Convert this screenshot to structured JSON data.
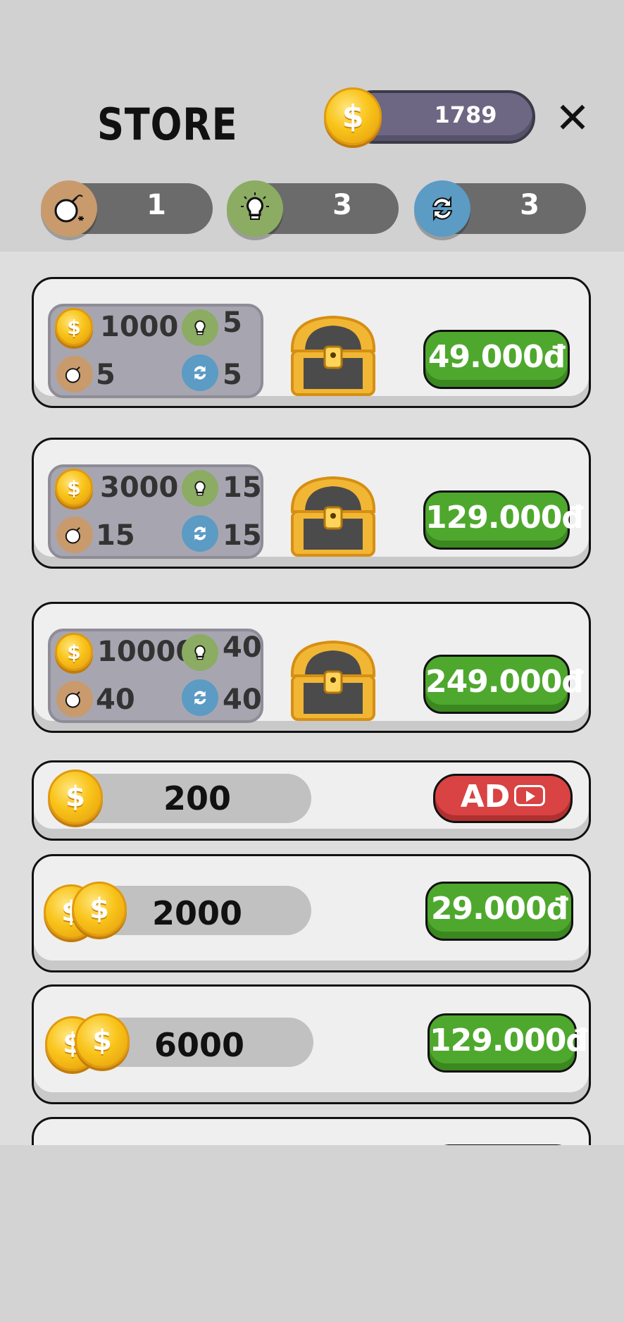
{
  "header": {
    "title": "STORE",
    "coin_balance": "1789",
    "close_symbol": "✕"
  },
  "resources": [
    {
      "name": "bomb",
      "icon": "bomb-icon",
      "count": "1"
    },
    {
      "name": "hint",
      "icon": "lightbulb-icon",
      "count": "3"
    },
    {
      "name": "shuffle",
      "icon": "shuffle-icon",
      "count": "3"
    }
  ],
  "bundles": [
    {
      "coins": "1000",
      "hints": "5",
      "bombs": "5",
      "shuffles": "5",
      "price": "49.000đ"
    },
    {
      "coins": "3000",
      "hints": "15",
      "bombs": "15",
      "shuffles": "15",
      "price": "129.000đ"
    },
    {
      "coins": "10000",
      "hints": "40",
      "bombs": "40",
      "shuffles": "40",
      "price": "249.000đ"
    }
  ],
  "coin_offers": [
    {
      "amount": "200",
      "button": "AD"
    },
    {
      "amount": "2000",
      "price": "29.000đ"
    },
    {
      "amount": "6000",
      "price": "129.000đ"
    }
  ],
  "icons": {
    "coin": "$"
  },
  "colors": {
    "price_green": "#4ea82d",
    "ad_red": "#d94343",
    "pill_purple": "#6d6783"
  }
}
